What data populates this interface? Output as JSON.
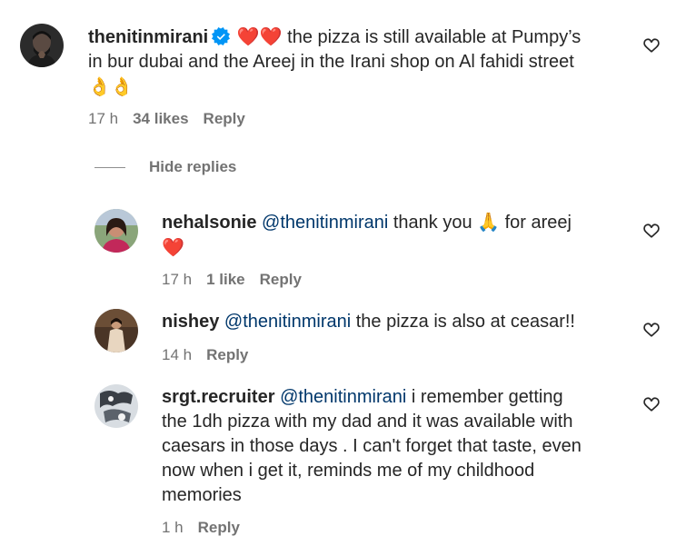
{
  "comments": [
    {
      "username": "thenitinmirani",
      "verified": true,
      "emoji_prefix": "❤️❤️",
      "line1": "the pizza is still available at Pumpy’s",
      "line2": "in bur dubai and the Areej in the Irani shop on Al fahidi street",
      "emoji_suffix": "👌👌",
      "time": "17 h",
      "likes": "34 likes",
      "reply": "Reply",
      "avatar_icon": "person-photo-avatar"
    }
  ],
  "hide_replies": "Hide replies",
  "replies": [
    {
      "username": "nehalsonie",
      "mention": "@thenitinmirani",
      "text": "thank you",
      "emoji_mid": "🙏",
      "text2": "for areej",
      "emoji_end": "❤️",
      "time": "17 h",
      "likes": "1 like",
      "reply": "Reply"
    },
    {
      "username": "nishey",
      "mention": "@thenitinmirani",
      "text": "the pizza is also at ceasar!!",
      "time": "14 h",
      "reply": "Reply"
    },
    {
      "username": "srgt.recruiter",
      "mention": "@thenitinmirani",
      "line1": "i remember getting",
      "line2": "the 1dh pizza with my dad and it was available with",
      "line3": "caesars in those days . I can't forget that taste, even",
      "line4": "now when i get it, reminds me of my childhood",
      "line5": "memories",
      "time": "1 h",
      "reply": "Reply"
    }
  ],
  "colors": {
    "text": "#262626",
    "secondary": "#737373",
    "mention": "#00376b",
    "verified": "#0095f6",
    "heart": "#ed1c24"
  }
}
